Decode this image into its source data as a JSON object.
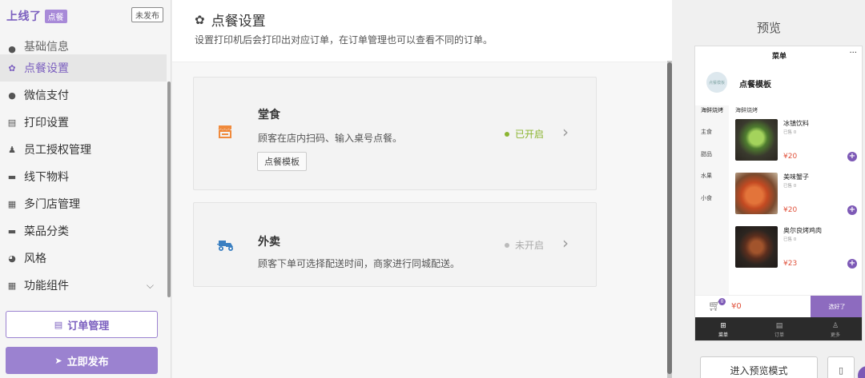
{
  "brand": {
    "name": "上线了",
    "tag": "点餐",
    "unpublished": "未发布"
  },
  "sidebar": {
    "items": [
      {
        "label": "基础信息",
        "icon": "info-icon"
      },
      {
        "label": "点餐设置",
        "icon": "gear-icon",
        "active": true
      },
      {
        "label": "微信支付",
        "icon": "wechat-pay-icon"
      },
      {
        "label": "打印设置",
        "icon": "printer-icon"
      },
      {
        "label": "员工授权管理",
        "icon": "user-add-icon"
      },
      {
        "label": "线下物料",
        "icon": "box-icon"
      },
      {
        "label": "多门店管理",
        "icon": "store-icon"
      },
      {
        "label": "菜品分类",
        "icon": "folder-icon"
      },
      {
        "label": "风格",
        "icon": "palette-icon"
      },
      {
        "label": "功能组件",
        "icon": "grid-icon"
      }
    ],
    "order_button": "订单管理",
    "publish_button": "立即发布"
  },
  "main": {
    "title": "点餐设置",
    "description": "设置打印机后会打印出对应订单，在订单管理也可以查看不同的订单。",
    "cards": [
      {
        "title": "堂食",
        "desc": "顾客在店内扫码、输入桌号点餐。",
        "button": "点餐模板",
        "status": "已开启",
        "status_color": "#8bb531",
        "icon": "storefront-icon",
        "icon_color": "#f08a3c"
      },
      {
        "title": "外卖",
        "desc": "顾客下单可选择配送时间，商家进行同城配送。",
        "status": "未开启",
        "status_color": "#bbbbbb",
        "icon": "delivery-scooter-icon",
        "icon_color": "#3a7fc1"
      }
    ]
  },
  "preview": {
    "title": "预览",
    "phone": {
      "header": "菜单",
      "more": "···",
      "store_logo": "点餐模板",
      "store_name": "点餐模板",
      "categories": [
        "海鲜烧烤",
        "主食",
        "甜品",
        "水果",
        "小食"
      ],
      "section_title": "海鲜烧烤",
      "dishes": [
        {
          "name": "冰镇饮料",
          "sold": "已售 0",
          "price": "¥20"
        },
        {
          "name": "美味蟹子",
          "sold": "已售 0",
          "price": "¥20"
        },
        {
          "name": "奥尔良烤鸡肉",
          "sold": "已售 0",
          "price": "¥23"
        }
      ],
      "cart_count": "0",
      "cart_amount": "¥0",
      "checkout": "选好了",
      "tabs": [
        {
          "label": "菜单",
          "icon": "menu-grid-icon"
        },
        {
          "label": "订单",
          "icon": "order-doc-icon"
        },
        {
          "label": "更多",
          "icon": "person-icon"
        }
      ]
    },
    "preview_button": "进入预览模式"
  }
}
